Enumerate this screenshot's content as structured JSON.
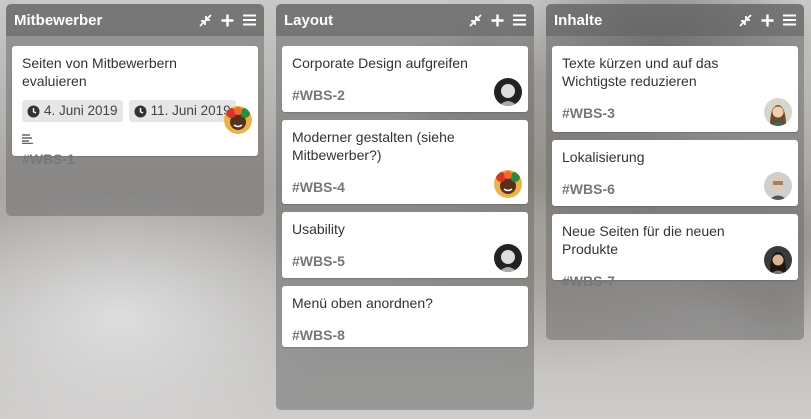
{
  "lists": [
    {
      "title": "Mitbewerber",
      "cards": [
        {
          "title": "Seiten von Mitbewerbern evaluieren",
          "start_date": "4. Juni 2019",
          "due_date": "11. Juni 2019",
          "id": "#WBS-1",
          "avatar": "avatar-colorful"
        }
      ]
    },
    {
      "title": "Layout",
      "cards": [
        {
          "title": "Corporate Design aufgreifen",
          "id": "#WBS-2",
          "avatar": "avatar-bw"
        },
        {
          "title": "Moderner gestalten (siehe Mitbewerber?)",
          "id": "#WBS-4",
          "avatar": "avatar-colorful"
        },
        {
          "title": "Usability",
          "id": "#WBS-5",
          "avatar": "avatar-bw"
        },
        {
          "title": "Menü oben anordnen?",
          "id": "#WBS-8"
        }
      ]
    },
    {
      "title": "Inhalte",
      "cards": [
        {
          "title": "Texte kürzen und auf das Wichtigste reduzieren",
          "id": "#WBS-3",
          "avatar": "avatar-woman"
        },
        {
          "title": "Lokalisierung",
          "id": "#WBS-6",
          "avatar": "avatar-man"
        },
        {
          "title": "Neue Seiten für die neuen Produkte",
          "id": "#WBS-7",
          "avatar": "avatar-woman-dark"
        }
      ]
    }
  ],
  "icons": {
    "collapse": "collapse-icon",
    "add": "plus-icon",
    "menu": "hamburger-icon",
    "clock": "clock-icon",
    "description": "description-icon"
  }
}
